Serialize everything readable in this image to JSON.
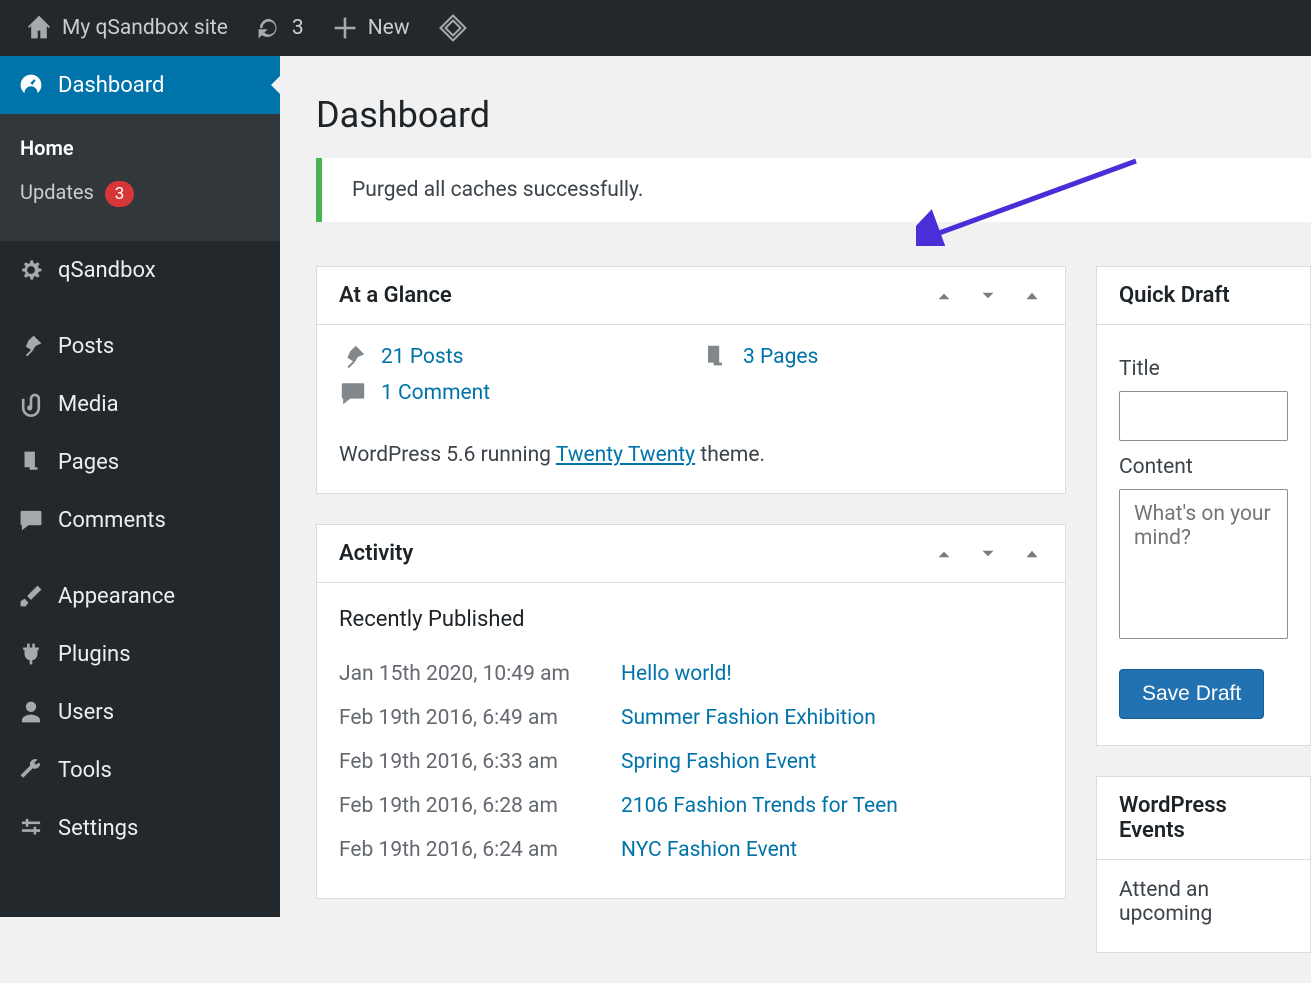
{
  "adminbar": {
    "site_name": "My qSandbox site",
    "refresh_count": "3",
    "new_label": "New"
  },
  "sidebar": {
    "dashboard": "Dashboard",
    "home": "Home",
    "updates": "Updates",
    "updates_count": "3",
    "qsandbox": "qSandbox",
    "posts": "Posts",
    "media": "Media",
    "pages": "Pages",
    "comments": "Comments",
    "appearance": "Appearance",
    "plugins": "Plugins",
    "users": "Users",
    "tools": "Tools",
    "settings": "Settings"
  },
  "page": {
    "title": "Dashboard",
    "notice": "Purged all caches successfully."
  },
  "glance": {
    "title": "At a Glance",
    "posts": "21 Posts",
    "pages": "3 Pages",
    "comments": "1 Comment",
    "version_pre": "WordPress 5.6 running ",
    "theme": "Twenty Twenty",
    "version_post": " theme."
  },
  "activity": {
    "title": "Activity",
    "section": "Recently Published",
    "rows": [
      {
        "date": "Jan 15th 2020, 10:49 am",
        "title": "Hello world!"
      },
      {
        "date": "Feb 19th 2016, 6:49 am",
        "title": "Summer Fashion Exhibition"
      },
      {
        "date": "Feb 19th 2016, 6:33 am",
        "title": "Spring Fashion Event"
      },
      {
        "date": "Feb 19th 2016, 6:28 am",
        "title": "2106 Fashion Trends for Teen"
      },
      {
        "date": "Feb 19th 2016, 6:24 am",
        "title": "NYC Fashion Event"
      }
    ]
  },
  "quickdraft": {
    "title": "Quick Draft",
    "title_label": "Title",
    "content_label": "Content",
    "content_placeholder": "What's on your mind?",
    "save": "Save Draft"
  },
  "events": {
    "title": "WordPress Events",
    "line": "Attend an upcoming"
  }
}
